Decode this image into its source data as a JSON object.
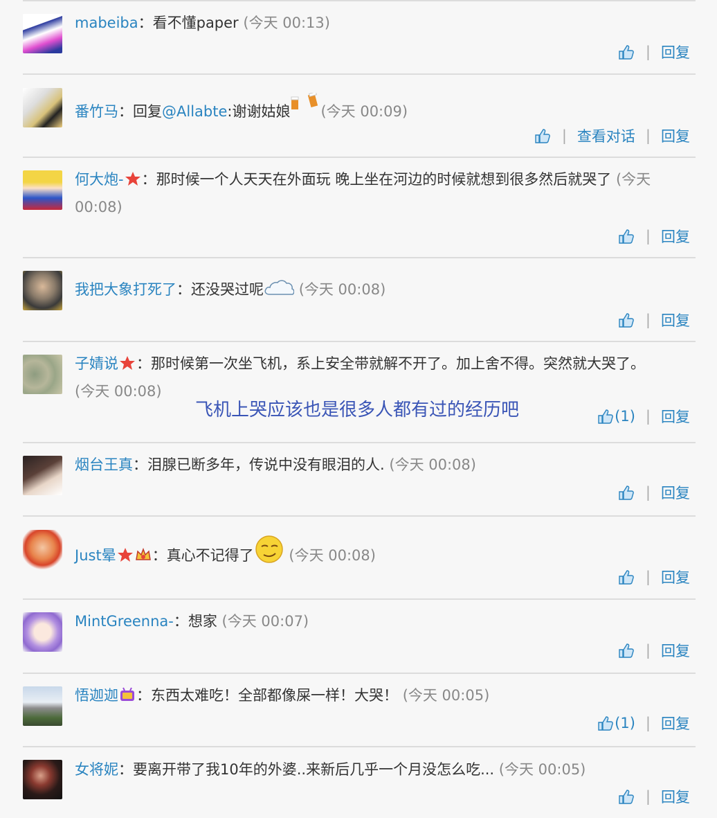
{
  "labels": {
    "reply": "回复",
    "view_conversation": "查看对话",
    "pipe": "|"
  },
  "overlay_caption": "飞机上哭应该也是很多人都有过的经历吧",
  "comments": [
    {
      "user": "mabeiba",
      "colon": "：",
      "text": "看不懂paper",
      "time": "(今天 00:13)",
      "likes": ""
    },
    {
      "user": "番竹马",
      "colon": "：",
      "pre": "回复",
      "mention": "@Allabte",
      "text": ":谢谢姑娘",
      "time": "(今天 00:09)",
      "likes": ""
    },
    {
      "user": "何大炮-",
      "colon": "：",
      "text": "那时候一个人天天在外面玩 晚上坐在河边的时候就想到很多然后就哭了",
      "time": "(今天 00:08)",
      "likes": ""
    },
    {
      "user": "我把大象打死了",
      "colon": "：",
      "text": "还没哭过呢",
      "time": "(今天 00:08)",
      "likes": ""
    },
    {
      "user": "子婧说",
      "colon": "：",
      "text": "那时候第一次坐飞机，系上安全带就解不开了。加上舍不得。突然就大哭了。",
      "time": "(今天 00:08)",
      "likes": "(1)"
    },
    {
      "user": "烟台王真",
      "colon": "：",
      "text": "泪腺已断多年，传说中没有眼泪的人.",
      "time": "(今天 00:08)",
      "likes": ""
    },
    {
      "user": "Just晕",
      "colon": "：",
      "text": "真心不记得了",
      "time": "(今天 00:08)",
      "likes": ""
    },
    {
      "user": "MintGreenna-",
      "colon": "：",
      "text": "想家",
      "time": "(今天 00:07)",
      "likes": ""
    },
    {
      "user": "悟迦迦",
      "colon": "：",
      "text": "东西太难吃！全部都像屎一样！大哭！",
      "time": "(今天 00:05)",
      "likes": "(1)"
    },
    {
      "user": "女将妮",
      "colon": "：",
      "text": "要离开带了我10年的外婆..来新后几乎一个月没怎么吃...",
      "time": "(今天 00:05)",
      "likes": ""
    }
  ],
  "colors": {
    "link": "#2a84c0",
    "time": "#888888",
    "separator": "#dcdcdc",
    "overlay": "#3a55b6",
    "badge_star": "#e8433a"
  },
  "icons": [
    "thumbs-up-icon",
    "star-badge-icon",
    "crown-badge-icon",
    "tv-badge-icon",
    "beer-emoji-icon",
    "cloud-emoji-icon",
    "smirk-emoji-icon"
  ]
}
